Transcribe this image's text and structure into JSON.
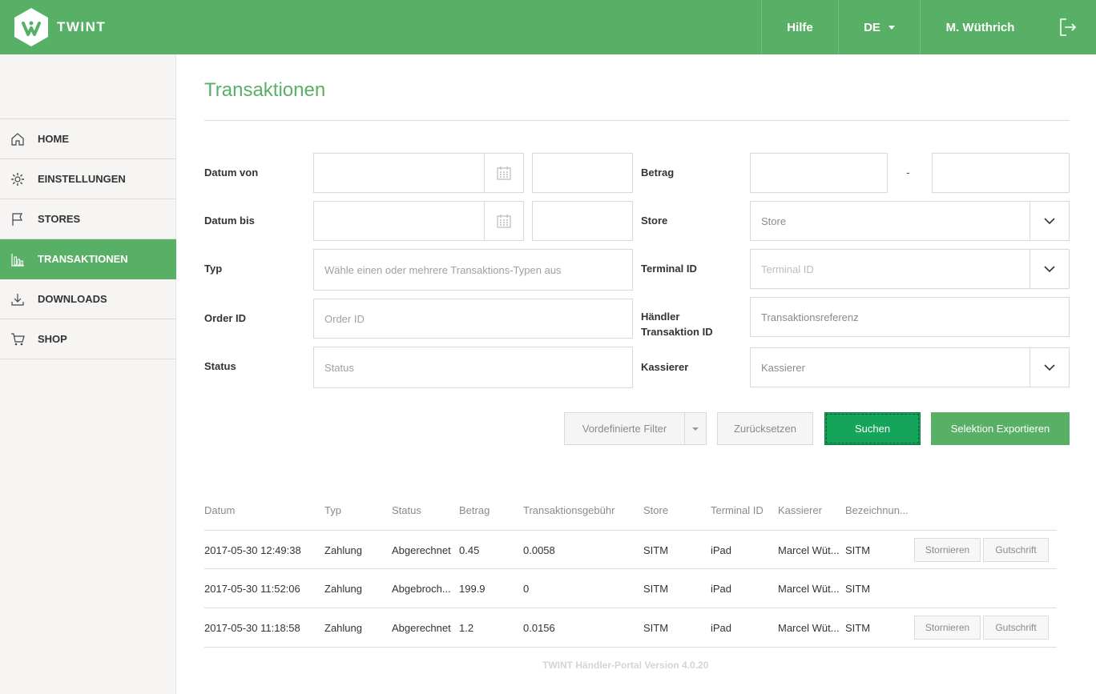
{
  "header": {
    "brand": "TWINT",
    "help": "Hilfe",
    "language": "DE",
    "user": "M. Wüthrich"
  },
  "sidebar": {
    "items": [
      {
        "label": "HOME",
        "icon": "home-icon"
      },
      {
        "label": "EINSTELLUNGEN",
        "icon": "gear-icon"
      },
      {
        "label": "STORES",
        "icon": "flag-icon"
      },
      {
        "label": "TRANSAKTIONEN",
        "icon": "bar-chart-icon",
        "active": true
      },
      {
        "label": "DOWNLOADS",
        "icon": "download-icon"
      },
      {
        "label": "SHOP",
        "icon": "cart-icon"
      }
    ]
  },
  "main": {
    "title": "Transaktionen",
    "filters": {
      "datum_von": "Datum von",
      "datum_bis": "Datum bis",
      "typ": "Typ",
      "typ_placeholder": "Wähle einen oder mehrere Transaktions-Typen aus",
      "order_id": "Order ID",
      "order_id_placeholder": "Order ID",
      "status": "Status",
      "status_placeholder": "Status",
      "betrag": "Betrag",
      "betrag_separator": "-",
      "store": "Store",
      "store_placeholder": "Store",
      "terminal_id": "Terminal ID",
      "terminal_id_placeholder": "Terminal ID",
      "haendler_line1": "Händler",
      "haendler_line2": "Transaktion ID",
      "haendler_placeholder": "Transaktionsreferenz",
      "kassierer": "Kassierer",
      "kassierer_placeholder": "Kassierer"
    },
    "buttons": {
      "predefined": "Vordefinierte Filter",
      "reset": "Zurücksetzen",
      "search": "Suchen",
      "export": "Selektion Exportieren"
    },
    "table": {
      "headers": [
        "Datum",
        "Typ",
        "Status",
        "Betrag",
        "Transaktionsgebühr",
        "Store",
        "Terminal ID",
        "Kassierer",
        "Bezeichnun..."
      ],
      "rows": [
        {
          "datum": "2017-05-30 12:49:38",
          "typ": "Zahlung",
          "status": "Abgerechnet",
          "betrag": "0.45",
          "gebuehr": "0.0058",
          "store": "SITM",
          "terminal": "iPad",
          "kassierer": "Marcel Wüt...",
          "bezeichnung": "SITM",
          "storno": "Stornieren",
          "gutschrift": "Gutschrift"
        },
        {
          "datum": "2017-05-30 11:52:06",
          "typ": "Zahlung",
          "status": "Abgebroch...",
          "betrag": "199.9",
          "gebuehr": "0",
          "store": "SITM",
          "terminal": "iPad",
          "kassierer": "Marcel Wüt...",
          "bezeichnung": "SITM"
        },
        {
          "datum": "2017-05-30 11:18:58",
          "typ": "Zahlung",
          "status": "Abgerechnet",
          "betrag": "1.2",
          "gebuehr": "0.0156",
          "store": "SITM",
          "terminal": "iPad",
          "kassierer": "Marcel Wüt...",
          "bezeichnung": "SITM",
          "storno": "Stornieren",
          "gutschrift": "Gutschrift"
        }
      ]
    },
    "footer": "TWINT Händler-Portal Version 4.0.20"
  },
  "colors": {
    "brand_green": "#58b066",
    "primary_button": "#14a55a"
  }
}
